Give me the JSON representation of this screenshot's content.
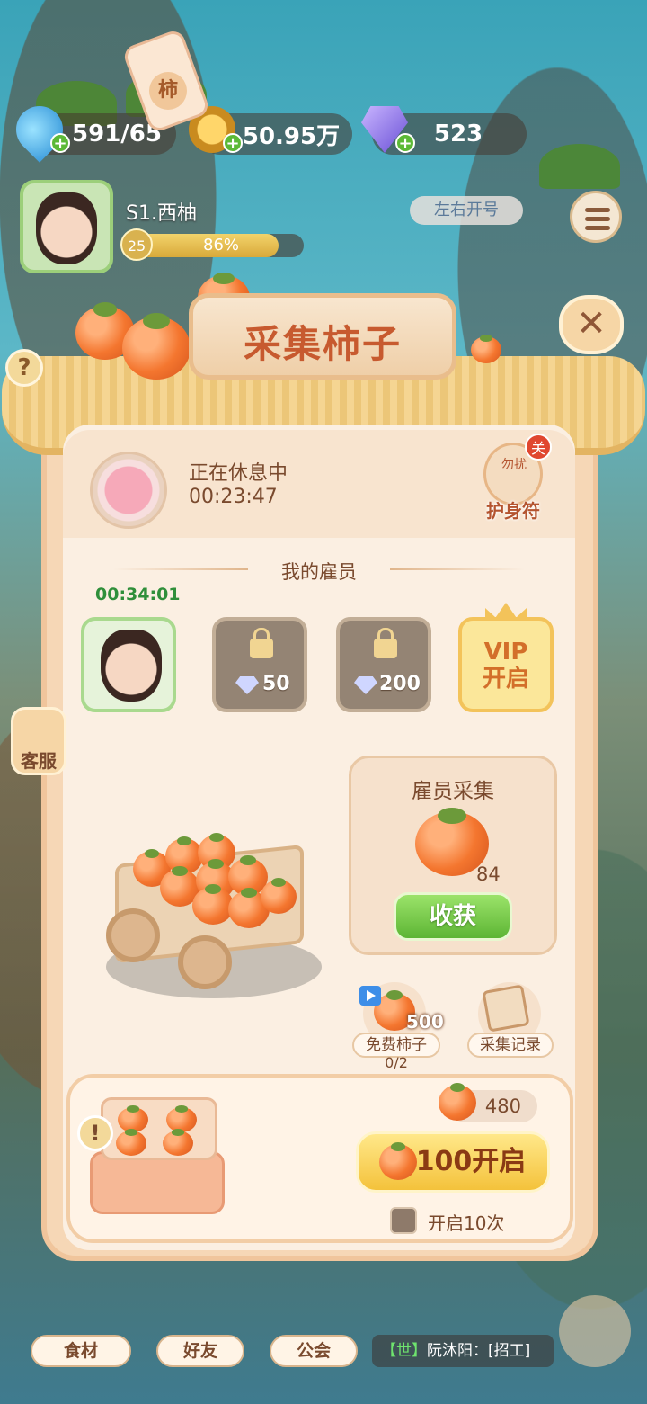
{
  "resources": {
    "water": "591/65",
    "coins": "50.95万",
    "gems": "523"
  },
  "player": {
    "name": "S1.西柚",
    "level": "25",
    "progress_text": "86%",
    "progress": 0.86,
    "server_tag": "左右开号"
  },
  "panel": {
    "title": "采集柿子",
    "status_title": "正在休息中",
    "status_timer": "00:23:47",
    "charm_label": "护身符",
    "charm_badge": "关",
    "charm_sign": "勿扰"
  },
  "employees": {
    "section_title": "我的雇员",
    "active_timer": "00:34:01",
    "slots": [
      {
        "type": "active"
      },
      {
        "type": "locked",
        "cost": "50"
      },
      {
        "type": "locked",
        "cost": "200"
      },
      {
        "type": "vip",
        "label": "VIP\n开启"
      }
    ]
  },
  "collect": {
    "title": "雇员采集",
    "count": "84",
    "harvest_label": "收获"
  },
  "extras": {
    "free_label": "免费柿子",
    "free_amount": "500",
    "free_progress": "0/2",
    "record_label": "采集记录"
  },
  "gift": {
    "seal_char": "柿",
    "stock": "480",
    "open_label": "100开启",
    "repeat_label": "开启10次",
    "repeat_checked": false
  },
  "side": {
    "service_label": "客服"
  },
  "nav": {
    "ingredients": "食材",
    "friends": "好友",
    "guild": "公会",
    "chat_channel": "【世】",
    "chat_text": "阮沐阳：[招工]"
  },
  "colors": {
    "title": "#c75a2f",
    "harvest": "#5db534",
    "open_button": "#f4c23b"
  }
}
